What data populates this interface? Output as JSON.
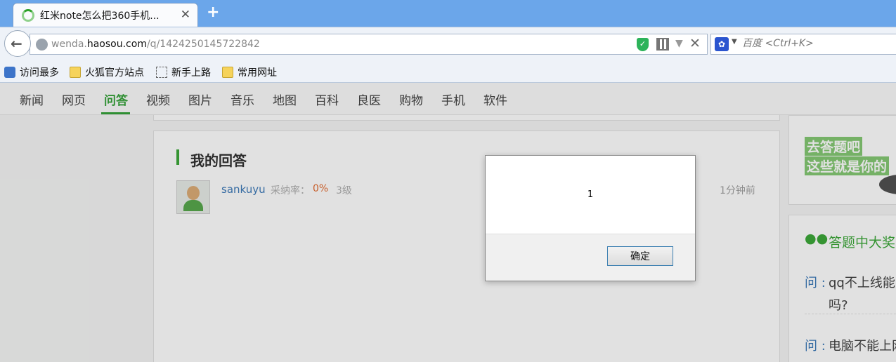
{
  "browser": {
    "tab": {
      "title": "红米note怎么把360手机...",
      "close": "✕"
    },
    "new_tab": "+",
    "back": "←",
    "url": {
      "sub": "wenda.",
      "domain": "haosou.com",
      "path": "/q/1424250145722842"
    },
    "search": {
      "placeholder": "百度 <Ctrl+K>"
    },
    "bookmarks": [
      {
        "label": "访问最多",
        "icon": "most-visited-icon"
      },
      {
        "label": "火狐官方站点",
        "icon": "folder-icon"
      },
      {
        "label": "新手上路",
        "icon": "blank-page-icon"
      },
      {
        "label": "常用网址",
        "icon": "folder-icon"
      }
    ]
  },
  "site_nav": [
    "新闻",
    "网页",
    "问答",
    "视频",
    "图片",
    "音乐",
    "地图",
    "百科",
    "良医",
    "购物",
    "手机",
    "软件"
  ],
  "site_nav_active": "问答",
  "answer_card": {
    "title": "我的回答",
    "username": "sankuyu",
    "adopt_label": "采纳率：",
    "adopt_rate": "0%",
    "level": "3级",
    "time": "1分钟前"
  },
  "sidebar": {
    "promo_lines": [
      "去答题吧",
      "这些就是你的"
    ],
    "contest_title": "答题中大奖",
    "questions": [
      {
        "label": "问 :",
        "lines": [
          "qq不上线能",
          "吗?"
        ]
      },
      {
        "label": "问 :",
        "lines": [
          "电脑不能上网"
        ]
      }
    ]
  },
  "dialog": {
    "message": "1",
    "ok_label": "确定"
  },
  "colors": {
    "tab_strip": "#6ba6ea",
    "accent_green": "#2ea12a",
    "link_blue": "#2e6fb3",
    "rate_orange": "#e06020"
  }
}
